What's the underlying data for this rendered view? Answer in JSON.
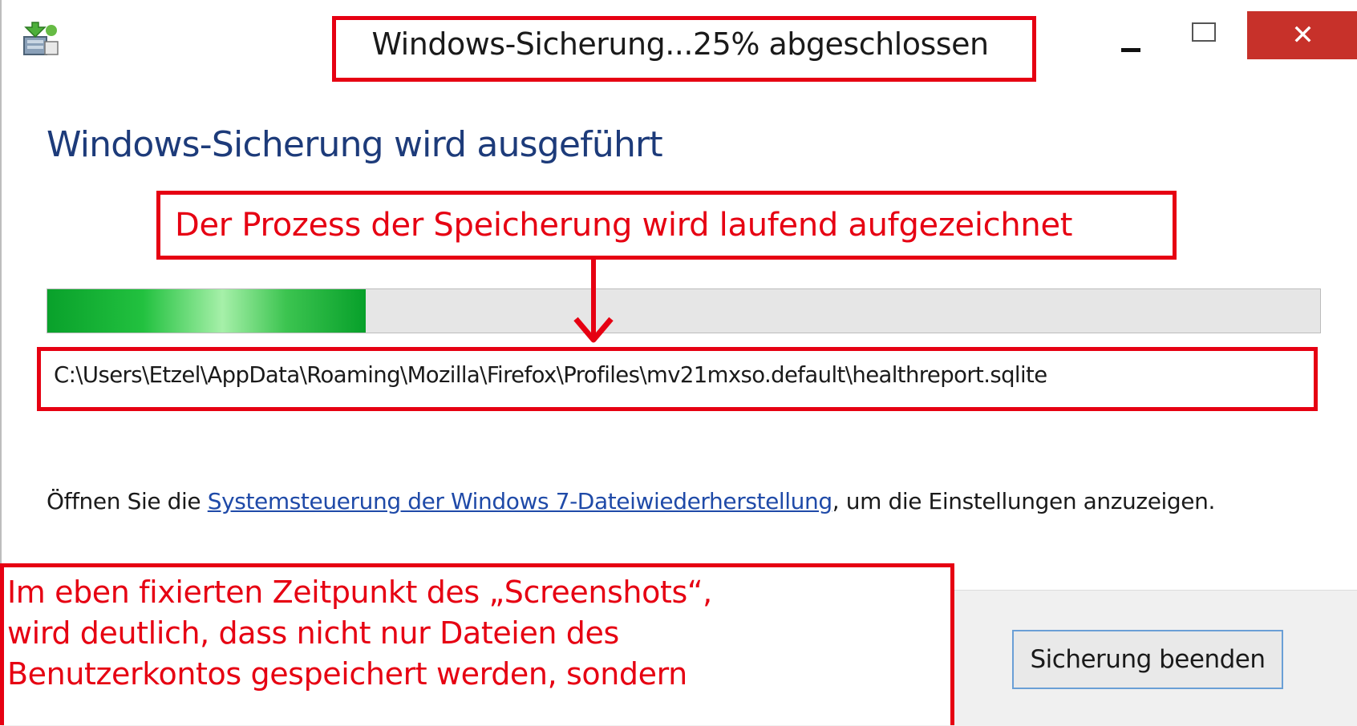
{
  "window": {
    "title": "Windows-Sicherung...25% abgeschlossen",
    "close_label": "✕",
    "icon": "windows-backup-icon"
  },
  "main": {
    "heading": "Windows-Sicherung wird ausgeführt",
    "progress_percent": 25,
    "current_file": "C:\\Users\\Etzel\\AppData\\Roaming\\Mozilla\\Firefox\\Profiles\\mv21mxso.default\\healthreport.sqlite",
    "info_prefix": "Öffnen Sie die ",
    "info_link": "Systemsteuerung der Windows 7-Dateiwiederherstellung",
    "info_suffix": ", um die Einstellungen anzuzeigen."
  },
  "footer": {
    "stop_button": "Sicherung beenden"
  },
  "annotations": {
    "process_note": "Der Prozess der Speicherung wird laufend aufgezeichnet",
    "note_lines": [
      "Im eben fixierten Zeitpunkt des „Screenshots“,",
      "wird deutlich, dass nicht nur Dateien des",
      "Benutzerkontos gespeichert werden, sondern"
    ],
    "color": "#e60012"
  },
  "colors": {
    "heading": "#1d3b7a",
    "link": "#1f4aa8",
    "close_button": "#c7312a",
    "progress_fill": "#09a12b"
  }
}
